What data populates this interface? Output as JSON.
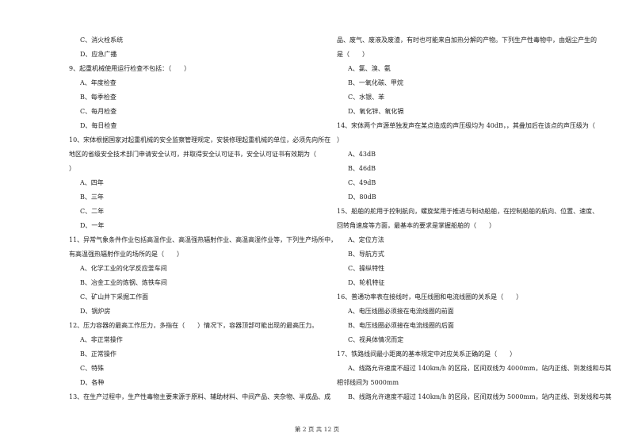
{
  "left_column": [
    {
      "type": "opt",
      "text": "C、消火栓系统"
    },
    {
      "type": "opt",
      "text": "D、应急广播"
    },
    {
      "type": "q",
      "text": "9、起重机械使用运行检查不包括：（　　）"
    },
    {
      "type": "opt",
      "text": "A、年度检查"
    },
    {
      "type": "opt",
      "text": "B、每季检查"
    },
    {
      "type": "opt",
      "text": "C、每月检查"
    },
    {
      "type": "opt",
      "text": "D、每日检查"
    },
    {
      "type": "q",
      "text": "10、宋体根据国家对起重机械的安全监察管理规定，安装修理起重机械的单位，必须先向所在"
    },
    {
      "type": "q",
      "text": "地区的省级安全技术部门申请安全认可，并取得安全认可证书，安全认可证书有效期为（"
    },
    {
      "type": "q",
      "text": "）"
    },
    {
      "type": "opt",
      "text": "A、四年"
    },
    {
      "type": "opt",
      "text": "B、三年"
    },
    {
      "type": "opt",
      "text": "C、二年"
    },
    {
      "type": "opt",
      "text": "D、一年"
    },
    {
      "type": "q",
      "text": "11、异常气象条件作业包括高温作业、高温强热辐射作业、高温高湿作业等，下列生产场所中，"
    },
    {
      "type": "q",
      "text": "有高温强热辐射作业的场所的是（　　）"
    },
    {
      "type": "opt",
      "text": "A、化学工业的化学反应釜车间"
    },
    {
      "type": "opt",
      "text": "B、冶金工业的炼钢、炼铁车间"
    },
    {
      "type": "opt",
      "text": "C、矿山井下采掘工作面"
    },
    {
      "type": "opt",
      "text": "D、锅炉房"
    },
    {
      "type": "q",
      "text": "12、压力容器的最高工作压力，多指在（　　）情况下，容器顶部可能出现的最高压力。"
    },
    {
      "type": "opt",
      "text": "A、非正常操作"
    },
    {
      "type": "opt",
      "text": "B、正常操作"
    },
    {
      "type": "opt",
      "text": "C、特殊"
    },
    {
      "type": "opt",
      "text": "D、各种"
    },
    {
      "type": "q",
      "text": "13、在生产过程中，生产性毒物主要来源于原料、辅助材料、中间产品、夹杂物、半成品、成"
    }
  ],
  "right_column": [
    {
      "type": "q",
      "text": "品、废气、废液及废渣，有时也可能来自加热分解的产物。下列生产性毒物中，由烟尘产生的"
    },
    {
      "type": "q",
      "text": "是（　　）"
    },
    {
      "type": "opt",
      "text": "A、氯、溴、氨"
    },
    {
      "type": "opt",
      "text": "B、一氧化碳、甲烷"
    },
    {
      "type": "opt",
      "text": "C、水银、苯"
    },
    {
      "type": "opt",
      "text": "D、氧化锌、氧化镉"
    },
    {
      "type": "q",
      "text": "14、宋体两个声源单独发声在某点造成的声压级均为 40dB，，其叠加后在该点的声压级为（"
    },
    {
      "type": "q",
      "text": "）"
    },
    {
      "type": "opt",
      "text": "A、43dB"
    },
    {
      "type": "opt",
      "text": "B、46dB"
    },
    {
      "type": "opt",
      "text": "C、49dB"
    },
    {
      "type": "opt",
      "text": "D、80dB"
    },
    {
      "type": "q",
      "text": "15、船舶的舵用于控制航向，螺旋桨用于推进与制动船舶，在控制船舶的航向、位置、速度、"
    },
    {
      "type": "q",
      "text": "回转角速度等方面，最基本的要求是掌握船舶的（　　）"
    },
    {
      "type": "opt",
      "text": "A、定位方法"
    },
    {
      "type": "opt",
      "text": "B、导航方式"
    },
    {
      "type": "opt",
      "text": "C、操纵特性"
    },
    {
      "type": "opt",
      "text": "D、轮机特征"
    },
    {
      "type": "q",
      "text": "16、普通功率表在接线时，电压线圈和电流线圈的关系是（　　）"
    },
    {
      "type": "opt",
      "text": "A、电压线圈必须接在电流线圈的前面"
    },
    {
      "type": "opt",
      "text": "B、电压线圈必须接在电流线圈的后面"
    },
    {
      "type": "opt",
      "text": "C、视具体情况而定"
    },
    {
      "type": "q",
      "text": "17、铁路线间最小距离的基本规定中对应关系正确的是（　　）"
    },
    {
      "type": "opt",
      "text": "A、线路允许速度不超过 140km/h 的区段，区间双线为 4000mm，站内正线、到发线和与其"
    },
    {
      "type": "q",
      "text": "相邻线间为 5000mm"
    },
    {
      "type": "opt",
      "text": "B、线路允许速度不超过 140km/h 的区段，区间双线为 5000mm，站内正线、到发线和与其"
    }
  ],
  "footer": {
    "page_label": "第 2 页 共 12 页"
  }
}
